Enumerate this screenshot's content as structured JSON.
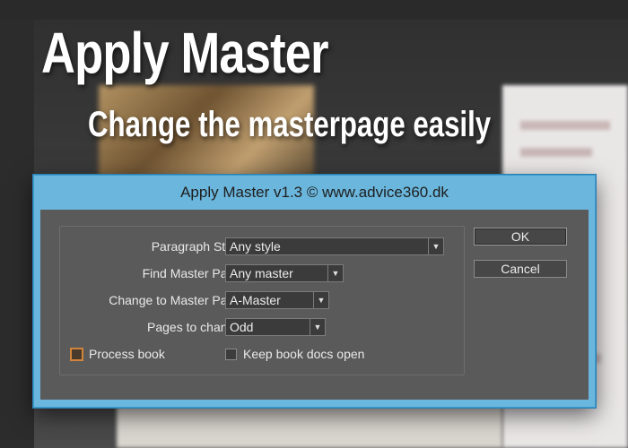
{
  "headline": "Apply Master",
  "subheadline": "Change the masterpage easily",
  "dialog": {
    "title": "Apply Master v1.3 © www.advice360.dk",
    "fields": [
      {
        "label": "Paragraph Style:",
        "value": "Any style"
      },
      {
        "label": "Find Master Page:",
        "value": "Any master"
      },
      {
        "label": "Change to Master Page:",
        "value": "A-Master"
      },
      {
        "label": "Pages to change:",
        "value": "Odd"
      }
    ],
    "checkboxes": [
      {
        "label": "Process book",
        "checked": false
      },
      {
        "label": "Keep book docs open",
        "checked": false
      }
    ],
    "buttons": {
      "ok": "OK",
      "cancel": "Cancel"
    },
    "dropdown_arrow": "▼"
  },
  "colors": {
    "titlebar": "#6bb6dc",
    "dialog_bg": "#5a5a5a",
    "focus_accent": "#d0853a"
  }
}
